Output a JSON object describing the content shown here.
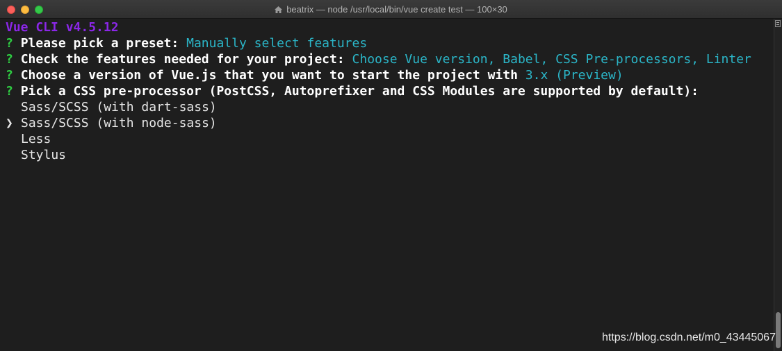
{
  "window": {
    "title": "beatrix — node /usr/local/bin/vue create test — 100×30"
  },
  "terminal": {
    "header": "Vue CLI v4.5.12",
    "prompt_mark": "?",
    "questions": [
      {
        "question": "Please pick a preset:",
        "answer": "Manually select features"
      },
      {
        "question": "Check the features needed for your project:",
        "answer": "Choose Vue version, Babel, CSS Pre-processors, Linter"
      },
      {
        "question": "Choose a version of Vue.js that you want to start the project with",
        "answer": "3.x (Preview)"
      },
      {
        "question": "Pick a CSS pre-processor (PostCSS, Autoprefixer and CSS Modules are supported by default):",
        "answer": ""
      }
    ],
    "selector": "❯",
    "options": [
      "Sass/SCSS (with dart-sass)",
      "Sass/SCSS (with node-sass)",
      "Less",
      "Stylus"
    ],
    "selected_index": 1
  },
  "watermark": "https://blog.csdn.net/m0_43445067",
  "colors": {
    "background": "#1e1e1e",
    "header": "#8b27e8",
    "prompt": "#2fd043",
    "answer": "#2bb6c8",
    "text": "#ffffff"
  },
  "icons": {
    "title_icon": "home-icon"
  }
}
